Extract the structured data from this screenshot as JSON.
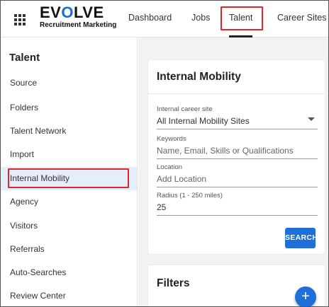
{
  "logo": {
    "main_pre": "EV",
    "main_o": "O",
    "main_post": "LVE",
    "sub": "Recruitment Marketing"
  },
  "nav": {
    "items": [
      {
        "label": "Dashboard"
      },
      {
        "label": "Jobs"
      },
      {
        "label": "Talent"
      },
      {
        "label": "Career Sites"
      }
    ]
  },
  "sidebar": {
    "title": "Talent",
    "items": [
      {
        "label": "Source"
      },
      {
        "label": "Folders"
      },
      {
        "label": "Talent Network"
      },
      {
        "label": "Import"
      },
      {
        "label": "Internal Mobility"
      },
      {
        "label": "Agency"
      },
      {
        "label": "Visitors"
      },
      {
        "label": "Referrals"
      },
      {
        "label": "Auto-Searches"
      },
      {
        "label": "Review Center"
      }
    ]
  },
  "mobility_card": {
    "title": "Internal Mobility",
    "site": {
      "label": "Internal career site",
      "value": "All Internal Mobility Sites"
    },
    "keywords": {
      "label": "Keywords",
      "placeholder": "Name, Email, Skills or Qualifications"
    },
    "location": {
      "label": "Location",
      "placeholder": "Add Location"
    },
    "radius": {
      "label": "Radius (1 - 250 miles)",
      "value": "25"
    },
    "search_label": "SEARCH"
  },
  "filters_card": {
    "title": "Filters",
    "add_label": "+"
  },
  "colors": {
    "accent": "#1f6fd9",
    "highlight": "#e0262b",
    "selected_bg": "#e6eefc"
  }
}
